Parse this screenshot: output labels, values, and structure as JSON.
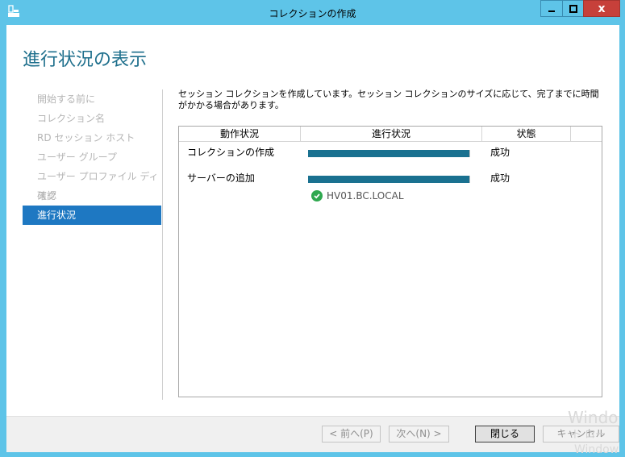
{
  "window": {
    "title": "コレクションの作成",
    "close_glyph": "x"
  },
  "page": {
    "heading": "進行状況の表示",
    "description": "セッション コレクションを作成しています。セッション コレクションのサイズに応じて、完了までに時間がかかる場合があります。"
  },
  "nav": {
    "items": [
      {
        "label": "開始する前に",
        "active": false
      },
      {
        "label": "コレクション名",
        "active": false
      },
      {
        "label": "RD セッション ホスト",
        "active": false
      },
      {
        "label": "ユーザー グループ",
        "active": false
      },
      {
        "label": "ユーザー プロファイル ディスク",
        "active": false
      },
      {
        "label": "確認",
        "active": false
      },
      {
        "label": "進行状況",
        "active": true
      }
    ]
  },
  "table": {
    "headers": [
      "動作状況",
      "進行状況",
      "状態"
    ],
    "rows": [
      {
        "label": "コレクションの作成",
        "progress": 1.0,
        "status": "成功"
      },
      {
        "label": "サーバーの追加",
        "progress": 1.0,
        "status": "成功"
      }
    ],
    "server": "HV01.BC.LOCAL"
  },
  "footer": {
    "prev_label": "< 前へ(P)",
    "next_label": "次へ(N) >",
    "close_label": "閉じる",
    "cancel_label": "キャンセル"
  },
  "watermark": {
    "line1": "Windo",
    "line2": "ト ロー",
    "line3": "Window"
  },
  "colors": {
    "titlebar": "#5ec4e8",
    "accent": "#1e78c2",
    "progress": "#1a7190",
    "success": "#2fa84f"
  }
}
